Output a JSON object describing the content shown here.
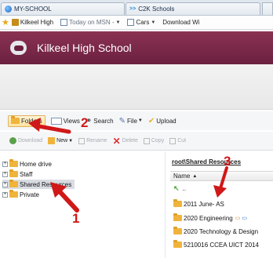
{
  "browser": {
    "tabs": [
      {
        "label": "MY-SCHOOL"
      },
      {
        "label": "C2K Schools"
      }
    ],
    "favorites": [
      {
        "label": "Kilkeel High"
      },
      {
        "label": "Today on MSN - "
      },
      {
        "label": "Cars "
      },
      {
        "label": "Download Wi"
      }
    ]
  },
  "header": {
    "school_name": "Kilkeel High School"
  },
  "toolbar": {
    "folders": "Folders",
    "views": "Views",
    "search": "Search",
    "file": "File",
    "upload": "Upload"
  },
  "toolbar2": {
    "download": "Download",
    "new": "New",
    "rename": "Rename",
    "delete": "Delete",
    "copy": "Copy",
    "cut": "Cut"
  },
  "tree": {
    "items": [
      {
        "label": "Home drive"
      },
      {
        "label": "Staff"
      },
      {
        "label": "Shared Resources"
      },
      {
        "label": "Private"
      }
    ]
  },
  "files": {
    "path": "root\\Shared Resources",
    "column_name": "Name",
    "parent": "..",
    "rows": [
      {
        "label": "2011 June- AS"
      },
      {
        "label": "2020 Engineering"
      },
      {
        "label": "2020 Technology & Design"
      },
      {
        "label": "5210016 CCEA UICT 2014"
      }
    ]
  },
  "annotations": {
    "marker_1": "1",
    "marker_2": "2",
    "marker_3": "3",
    "color": "#d01818"
  },
  "colors": {
    "banner": "#6c2040",
    "folder": "#f0b43c"
  }
}
